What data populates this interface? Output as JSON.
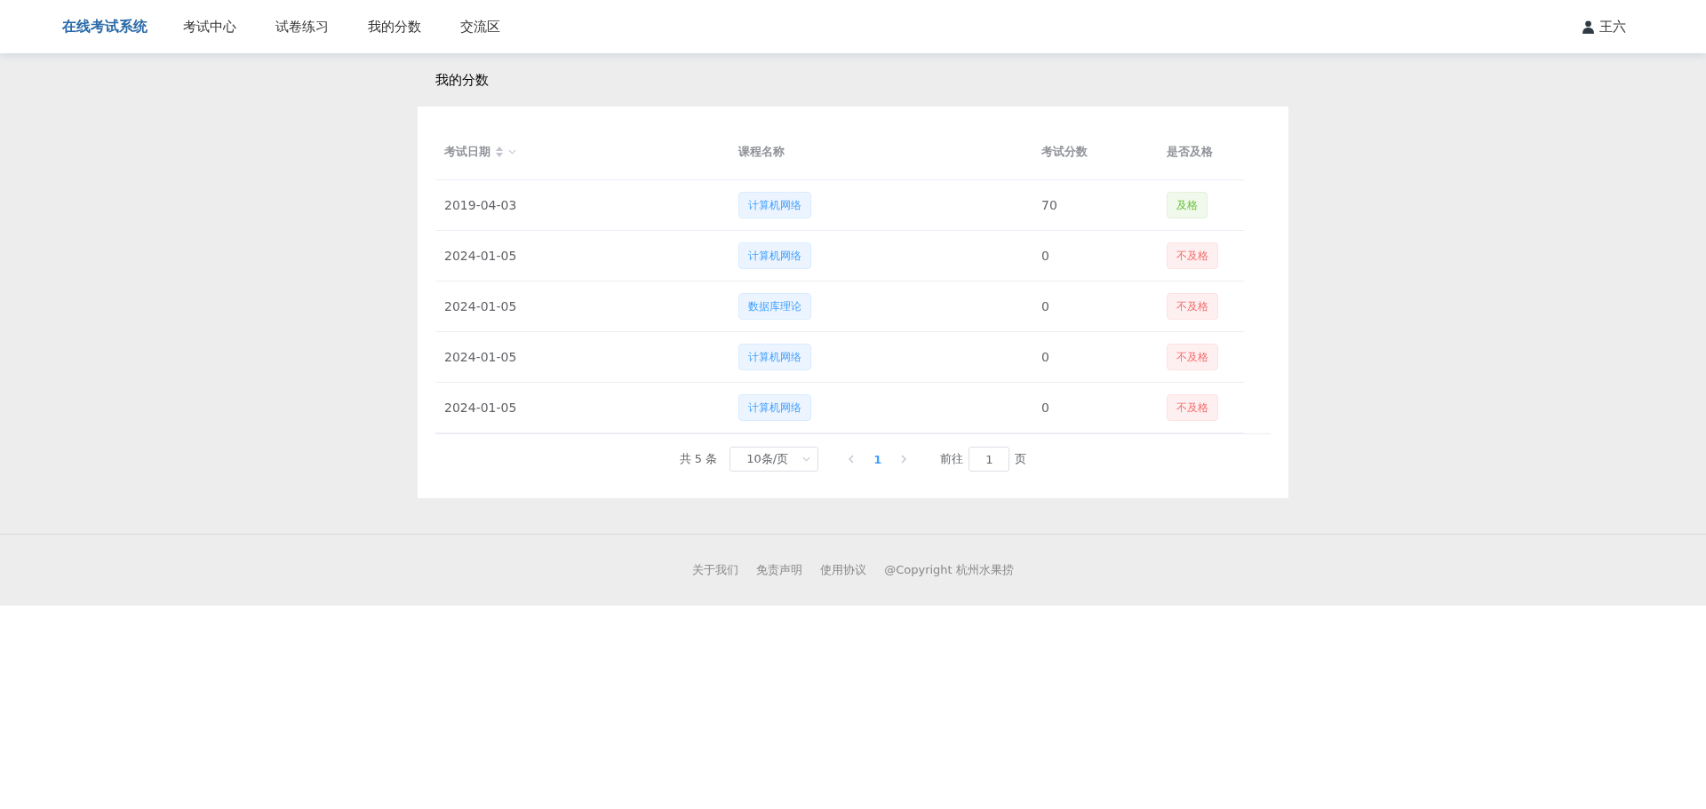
{
  "nav": {
    "brand": "在线考试系统",
    "items": [
      {
        "label": "考试中心"
      },
      {
        "label": "试卷练习"
      },
      {
        "label": "我的分数"
      },
      {
        "label": "交流区"
      }
    ],
    "user": "王六"
  },
  "page_title": "我的分数",
  "table": {
    "columns": [
      {
        "label": "考试日期",
        "sortable": true
      },
      {
        "label": "课程名称",
        "sortable": false
      },
      {
        "label": "考试分数",
        "sortable": false
      },
      {
        "label": "是否及格",
        "sortable": false
      }
    ],
    "rows": [
      {
        "date": "2019-04-03",
        "course": "计算机网络",
        "score": "70",
        "result": {
          "text": "及格",
          "passed": true
        }
      },
      {
        "date": "2024-01-05",
        "course": "计算机网络",
        "score": "0",
        "result": {
          "text": "不及格",
          "passed": false
        }
      },
      {
        "date": "2024-01-05",
        "course": "数据库理论",
        "score": "0",
        "result": {
          "text": "不及格",
          "passed": false
        }
      },
      {
        "date": "2024-01-05",
        "course": "计算机网络",
        "score": "0",
        "result": {
          "text": "不及格",
          "passed": false
        }
      },
      {
        "date": "2024-01-05",
        "course": "计算机网络",
        "score": "0",
        "result": {
          "text": "不及格",
          "passed": false
        }
      }
    ]
  },
  "pagination": {
    "total": "共 5 条",
    "page_size": "10条/页",
    "pages": [
      {
        "label": "1",
        "selected": true
      }
    ],
    "goto_label": "前往",
    "goto_value": "1",
    "goto_suffix": "页"
  },
  "footer": {
    "links": [
      "关于我们",
      "免责声明",
      "使用协议"
    ],
    "copyright": "@Copyright 杭州水果捞"
  }
}
